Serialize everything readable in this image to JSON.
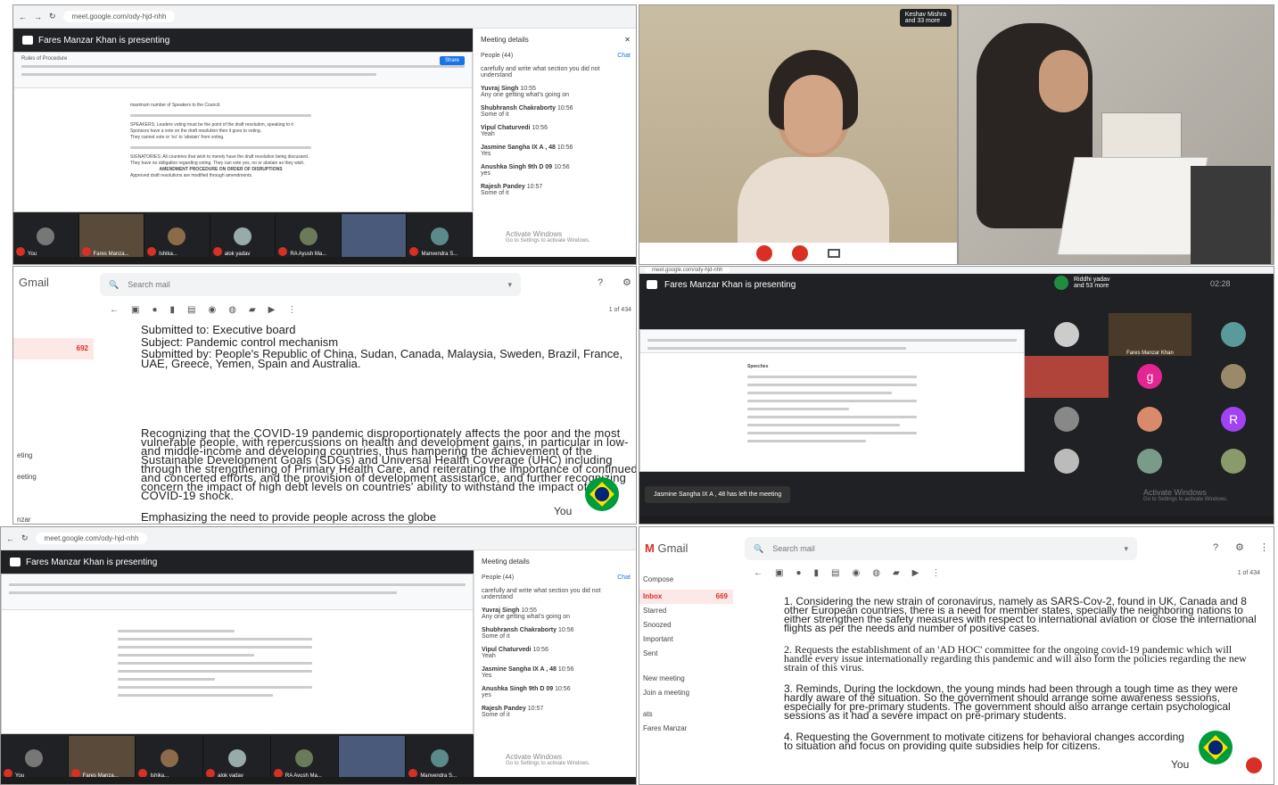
{
  "panel1": {
    "url": "meet.google.com/ody-hjd-nhh",
    "presenting": "Fares Manzar Khan is presenting",
    "doc_title": "Rules of Procedure",
    "share_label": "Share",
    "doc_lines": [
      "maximum number of Speakers to the Council.",
      "SPEAKERS: Leaders voting must be the point of the draft resolution, speaking to it",
      "Sponsors have a vote on the draft resolution then it goes to voting.",
      "They cannot vote or 'no' to 'abstain' from voting.",
      "SIGNATORIES: All countries that wish to merely have the draft resolution being discussed.",
      "They have no obligation regarding voting. They can vote yes, no or abstain as they wish.",
      "AMENDMENT PROCEDURE ON ORDER OF DISRUPTIONS",
      "Approved draft resolutions are modified through amendments."
    ],
    "details_title": "Meeting details",
    "people_label": "People (44)",
    "chat_label": "Chat",
    "chat_top": "carefully and write what section you did not understand",
    "messages": [
      {
        "name": "Yuvraj Singh",
        "time": "10:55",
        "text": "Any one getting what's going on"
      },
      {
        "name": "Shubhransh Chakraborty",
        "time": "10:56",
        "text": "Some of it"
      },
      {
        "name": "Vipul Chaturvedi",
        "time": "10:56",
        "text": "Yeah"
      },
      {
        "name": "Jasmine Sangha IX A , 48",
        "time": "10:56",
        "text": "Yes"
      },
      {
        "name": "Anushka Singh 9th D 09",
        "time": "10:56",
        "text": "yes"
      },
      {
        "name": "Rajesh Pandey",
        "time": "10:57",
        "text": "Some of it"
      }
    ],
    "activate": "Activate Windows",
    "activate_sub": "Go to Settings to activate Windows.",
    "tiles": [
      "You",
      "Fares Manza...",
      "Ishika...",
      "alok yadav",
      "RA Ayush Ma...",
      "",
      "Manvendra S..."
    ]
  },
  "panel2": {
    "caller": "Keshav Mishra",
    "caller_sub": "and 33 more"
  },
  "panel3": {
    "logo": "Gmail",
    "search_placeholder": "Search mail",
    "count": "1 of 434",
    "unread": "692",
    "side_items": [
      "",
      "",
      "",
      "",
      "",
      "eting",
      "eeting",
      "",
      "nzar"
    ],
    "line1": "Submitted to: Executive board",
    "line2": "Subject: Pandemic control mechanism",
    "line3": "Submitted by: People's Republic of China, Sudan, Canada, Malaysia, Sweden, Brazil, France, UAE, Greece, Yemen, Spain and Australia.",
    "para": "Recognizing that the COVID-19 pandemic disproportionately affects the poor and the most vulnerable people, with repercussions on health and development gains, in particular in low- and middle-income and developing countries, thus hampering the achievement of the Sustainable Development Goals (SDGs) and Universal Health Coverage (UHC) including through the strengthening of Primary Health Care, and reiterating the importance of continued and concerted efforts, and the provision of development assistance, and further recognizing concern the impact of high debt levels on countries' ability to withstand the impact of the COVID-19 shock.",
    "next": "Emphasizing the need to provide people across the globe",
    "you": "You"
  },
  "panel4": {
    "url": "meet.google.com/ody-hjd-nhh",
    "presenting": "Fares Manzar Khan is presenting",
    "caller": "Riddhi yadav",
    "caller_sub": "and 53 more",
    "time": "02:28",
    "doc_heading": "Speeches",
    "notice": "Jasmine Sangha IX A , 48 has left the meeting",
    "host_tile": "Fares Manzar Khan",
    "tile_letters": [
      "g",
      "R"
    ],
    "activate": "Activate Windows",
    "activate_sub": "Go to Settings to activate Windows."
  },
  "panel5": {
    "url": "meet.google.com/ody-hjd-nhh",
    "presenting": "Fares Manzar Khan is presenting",
    "details_title": "Meeting details",
    "people_label": "People (44)",
    "chat_label": "Chat",
    "chat_top": "carefully and write what section you did not understand",
    "messages": [
      {
        "name": "Yuvraj Singh",
        "time": "10:55",
        "text": "Any one getting what's going on"
      },
      {
        "name": "Shubhransh Chakraborty",
        "time": "10:56",
        "text": "Some of it"
      },
      {
        "name": "Vipul Chaturvedi",
        "time": "10:56",
        "text": "Yeah"
      },
      {
        "name": "Jasmine Sangha IX A , 48",
        "time": "10:56",
        "text": "Yes"
      },
      {
        "name": "Anushka Singh 9th D 09",
        "time": "10:56",
        "text": "yes"
      },
      {
        "name": "Rajesh Pandey",
        "time": "10:57",
        "text": "Some of it"
      }
    ],
    "activate": "Activate Windows",
    "activate_sub": "Go to Settings to activate Windows.",
    "tiles": [
      "You",
      "Fares Manza...",
      "Ishika...",
      "alok yadav",
      "RA Ayush Ma...",
      "",
      "Manvendra S..."
    ]
  },
  "panel6": {
    "logo": "Gmail",
    "search_placeholder": "Search mail",
    "count": "1 of 434",
    "unread": "669",
    "side_items": [
      "Compose",
      "Inbox",
      "Starred",
      "Snoozed",
      "Important",
      "Sent",
      "",
      "New meeting",
      "Join a meeting",
      "",
      "ats",
      "Fares Manzar"
    ],
    "items": [
      "1. Considering the new strain of coronavirus, namely as SARS-Cov-2, found in UK, Canada and 8 other European countries, there is a need for member states, specially the neighboring nations to either strengthen the safety measures with respect to international aviation or close the international flights as per the needs and number of positive cases.",
      "2. Requests the establishment of an 'AD HOC' committee for the ongoing covid-19 pandemic which will handle every issue internationally regarding this pandemic and will also form the policies regarding the new strain of this virus.",
      "3. Reminds, During the lockdown, the young minds had been through a tough time as they were hardly aware of the situation. So the government should arrange some awareness sessions, especially for pre-primary students. The government should also arrange certain psychological sessions as it had a severe impact on pre-primary students.",
      "4. Requesting the Government to motivate citizens for behavioral changes according to situation and focus on providing quite subsidies help for citizens."
    ],
    "you": "You"
  }
}
